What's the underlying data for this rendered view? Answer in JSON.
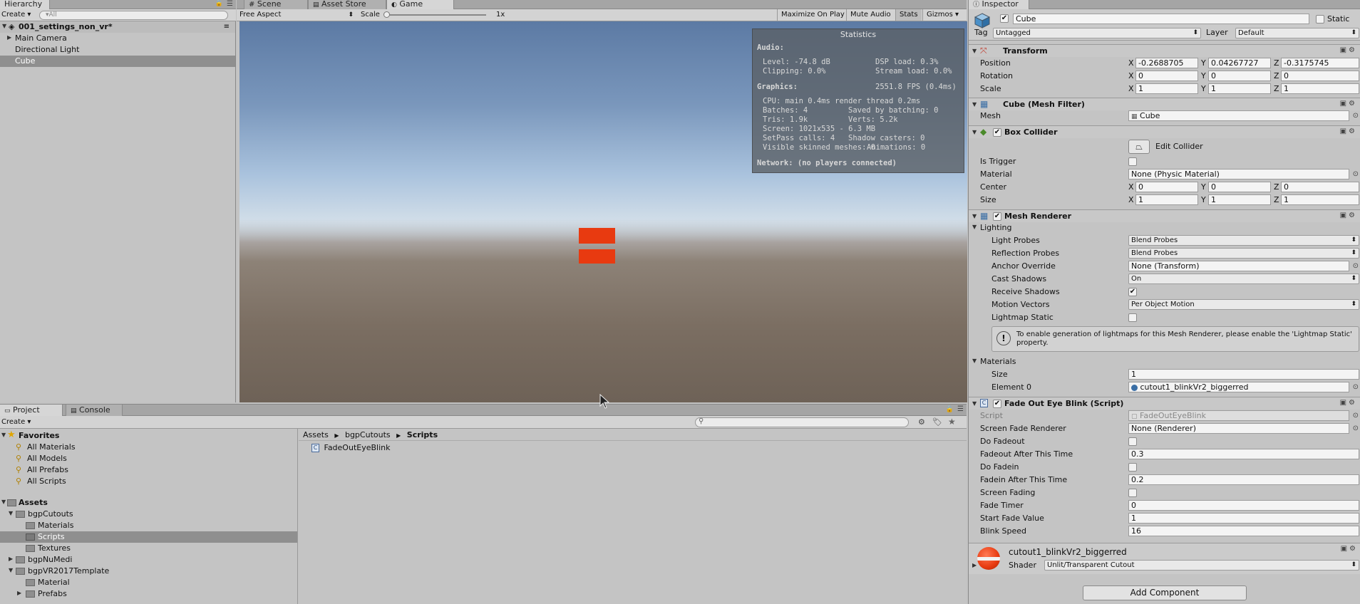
{
  "hierarchy": {
    "tab_label": "Hierarchy",
    "create_label": "Create ▾",
    "search_placeholder": "▾All",
    "scene_name": "001_settings_non_vr*",
    "items": [
      {
        "label": "Main Camera"
      },
      {
        "label": "Directional Light"
      },
      {
        "label": "Cube"
      }
    ]
  },
  "view_tabs": {
    "scene": "Scene",
    "asset_store": "Asset Store",
    "game": "Game"
  },
  "game_toolbar": {
    "aspect": "Free Aspect",
    "scale_label": "Scale",
    "scale_value": "1x",
    "scale_level": 0,
    "maximize": "Maximize On Play",
    "mute": "Mute Audio",
    "stats": "Stats",
    "gizmos": "Gizmos ▾"
  },
  "stats": {
    "title": "Statistics",
    "audio_label": "Audio:",
    "level": "Level: -74.8 dB",
    "dsp": "DSP load: 0.3%",
    "clipping": "Clipping: 0.0%",
    "stream": "Stream load: 0.0%",
    "graphics_label": "Graphics:",
    "fps": "2551.8 FPS (0.4ms)",
    "cpu": "CPU: main 0.4ms  render thread 0.2ms",
    "batches": "Batches: 4",
    "saved": "Saved by batching: 0",
    "tris": "Tris: 1.9k",
    "verts": "Verts: 5.2k",
    "screen": "Screen: 1021x535 - 6.3 MB",
    "setpass": "SetPass calls: 4",
    "shadow_casters": "Shadow casters: 0",
    "skinned": "Visible skinned meshes: 0",
    "animations": "Animations: 0",
    "network": "Network: (no players connected)"
  },
  "inspector": {
    "tab_label": "Inspector",
    "object_name": "Cube",
    "static_label": "Static",
    "tag_label": "Tag",
    "tag_value": "Untagged",
    "layer_label": "Layer",
    "layer_value": "Default",
    "transform": {
      "title": "Transform",
      "position_label": "Position",
      "rotation_label": "Rotation",
      "scale_label": "Scale",
      "position": {
        "x": "-0.2688705",
        "y": "0.04267727",
        "z": "-0.3175745"
      },
      "rotation": {
        "x": "0",
        "y": "0",
        "z": "0"
      },
      "scale": {
        "x": "1",
        "y": "1",
        "z": "1"
      },
      "x": "X",
      "y": "Y",
      "z": "Z"
    },
    "mesh_filter": {
      "title": "Cube (Mesh Filter)",
      "mesh_label": "Mesh",
      "mesh_value": "Cube"
    },
    "box_collider": {
      "title": "Box Collider",
      "edit_collider": "Edit Collider",
      "is_trigger": "Is Trigger",
      "material_label": "Material",
      "material_value": "None (Physic Material)",
      "center_label": "Center",
      "center": {
        "x": "0",
        "y": "0",
        "z": "0"
      },
      "size_label": "Size",
      "size": {
        "x": "1",
        "y": "1",
        "z": "1"
      }
    },
    "mesh_renderer": {
      "title": "Mesh Renderer",
      "lighting": "Lighting",
      "light_probes_label": "Light Probes",
      "light_probes_value": "Blend Probes",
      "reflection_probes_label": "Reflection Probes",
      "reflection_probes_value": "Blend Probes",
      "anchor_label": "Anchor Override",
      "anchor_value": "None (Transform)",
      "cast_shadows_label": "Cast Shadows",
      "cast_shadows_value": "On",
      "receive_shadows_label": "Receive Shadows",
      "motion_vectors_label": "Motion Vectors",
      "motion_vectors_value": "Per Object Motion",
      "lightmap_static_label": "Lightmap Static",
      "info": "To enable generation of lightmaps for this Mesh Renderer, please enable the 'Lightmap Static' property.",
      "materials": "Materials",
      "size_label": "Size",
      "size_value": "1",
      "element0_label": "Element 0",
      "element0_value": "cutout1_blinkVr2_biggerred"
    },
    "script": {
      "title": "Fade Out Eye Blink (Script)",
      "script_label": "Script",
      "script_value": "FadeOutEyeBlink",
      "fields": [
        {
          "label": "Screen Fade Renderer",
          "value": "None (Renderer)"
        },
        {
          "label": "Do Fadeout",
          "value": ""
        },
        {
          "label": "Fadeout After This Time",
          "value": "0.3"
        },
        {
          "label": "Do Fadein",
          "value": ""
        },
        {
          "label": "Fadein After This Time",
          "value": "0.2"
        },
        {
          "label": "Screen Fading",
          "value": ""
        },
        {
          "label": "Fade Timer",
          "value": "0"
        },
        {
          "label": "Start Fade Value",
          "value": "1"
        },
        {
          "label": "Blink Speed",
          "value": "16"
        }
      ]
    },
    "material": {
      "name": "cutout1_blinkVr2_biggerred",
      "shader_label": "Shader",
      "shader_value": "Unlit/Transparent Cutout"
    },
    "add_component": "Add Component"
  },
  "project": {
    "tab_project": "Project",
    "tab_console": "Console",
    "create_label": "Create ▾",
    "favorites_label": "Favorites",
    "favorites": [
      "All Materials",
      "All Models",
      "All Prefabs",
      "All Scripts"
    ],
    "assets_label": "Assets",
    "tree": [
      {
        "label": "bgpCutouts",
        "depth": 1
      },
      {
        "label": "Materials",
        "depth": 2
      },
      {
        "label": "Scripts",
        "depth": 2
      },
      {
        "label": "Textures",
        "depth": 2
      },
      {
        "label": "bgpNuMedi",
        "depth": 1
      },
      {
        "label": "bgpVR2017Template",
        "depth": 1
      },
      {
        "label": "Material",
        "depth": 2
      },
      {
        "label": "Prefabs",
        "depth": 2
      }
    ],
    "breadcrumb": [
      "Assets",
      "bgpCutouts",
      "Scripts"
    ],
    "files": [
      "FadeOutEyeBlink"
    ]
  },
  "colors": {
    "cube_red": "#e83a10",
    "selection": "#8f8f8f"
  }
}
